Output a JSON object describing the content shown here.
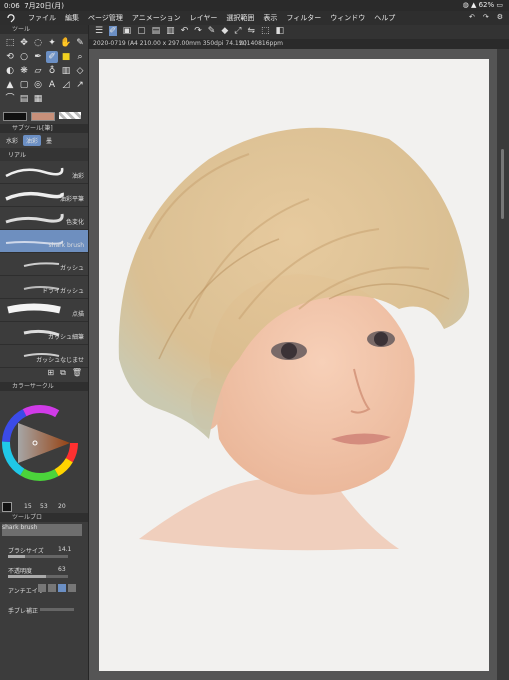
{
  "status": {
    "time": "0:06",
    "date": "7月20日(月)",
    "battery": "62%"
  },
  "menu": {
    "items": [
      "ファイル",
      "編集",
      "ページ管理",
      "アニメーション",
      "レイヤー",
      "選択範囲",
      "表示",
      "フィルター",
      "ウィンドウ",
      "ヘルプ"
    ]
  },
  "tool_panel": {
    "title": "ツール"
  },
  "subtool_panel": {
    "title": "サブツール[筆]",
    "tabs": [
      "水彩",
      "油彩",
      "墨"
    ],
    "group": "リアル",
    "brushes": [
      "油彩",
      "油彩平筆",
      "色変化",
      "shark brush",
      "ガッシュ",
      "ドライガッシュ",
      "点描",
      "ガッシュ細筆",
      "ガッシュなじませ"
    ],
    "selected": "shark brush"
  },
  "color_panel": {
    "title": "カラーサークル",
    "readout": [
      "15",
      "53",
      "20"
    ]
  },
  "tool_property": {
    "title": "ツールプロ",
    "brush_name": "shark brush",
    "brush_size_label": "ブラシサイズ",
    "brush_size_value": "14.1",
    "opacity_label": "不透明度",
    "opacity_value": "63",
    "antialias_label": "アンチエイリ",
    "stabilization_label": "手ブレ補正"
  },
  "document": {
    "tab1": "2020-0719 (A4 210.00 x 297.00mm 350dpi 74.1%)",
    "tab2": "20140816ppm"
  },
  "colors": {
    "main": "#101010",
    "sub": "#c8907a",
    "accent": "#6b8fc4"
  }
}
